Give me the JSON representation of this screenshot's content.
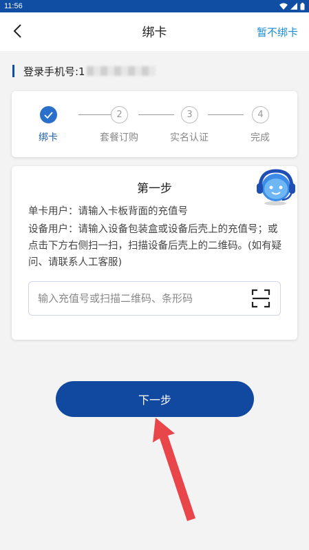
{
  "status_bar": {
    "time": "11:56"
  },
  "header": {
    "title": "绑卡",
    "skip_label": "暂不绑卡"
  },
  "account": {
    "phone_label": "登录手机号:1"
  },
  "steps": [
    {
      "number": "",
      "label": "绑卡",
      "state": "done"
    },
    {
      "number": "2",
      "label": "套餐订购",
      "state": "todo"
    },
    {
      "number": "3",
      "label": "实名认证",
      "state": "todo"
    },
    {
      "number": "4",
      "label": "完成",
      "state": "todo"
    }
  ],
  "form": {
    "title": "第一步",
    "desc_single": "单卡用户：请输入卡板背面的充值号",
    "desc_device": "设备用户：请输入设备包装盒或设备后壳上的充值号；或点击下方右侧扫一扫，扫描设备后壳上的二维码。(如有疑问、请联系人工客服)",
    "input_value": "",
    "input_placeholder": "输入充值号或扫描二维码、条形码"
  },
  "actions": {
    "next_label": "下一步"
  },
  "colors": {
    "primary": "#1149a0",
    "accent": "#1a8ad8",
    "status_bar": "#0f4ea3",
    "step_done": "#2a6fc9",
    "arrow": "#e8464a"
  },
  "icons": {
    "back": "back-arrow-icon",
    "done": "check-icon",
    "scan": "scan-icon",
    "support": "customer-service-bot-icon"
  }
}
